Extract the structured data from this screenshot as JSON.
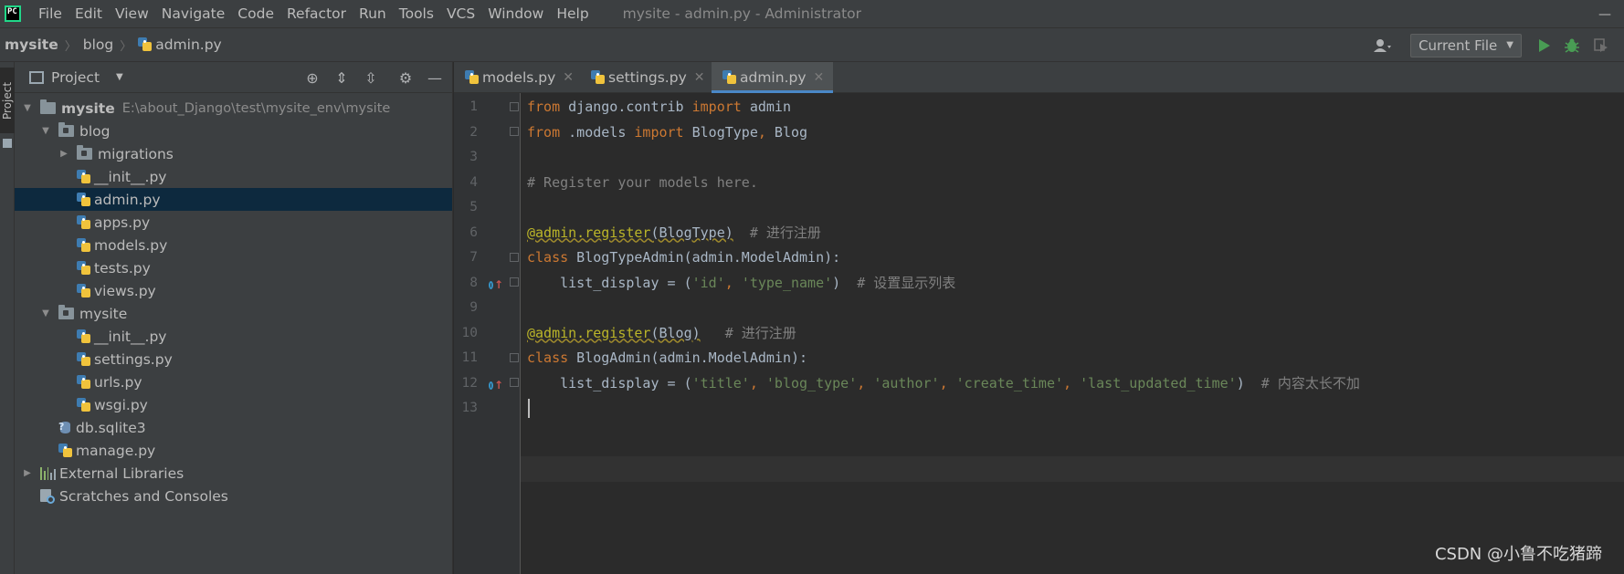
{
  "menubar": {
    "logo_text": "PC",
    "items": [
      "File",
      "Edit",
      "View",
      "Navigate",
      "Code",
      "Refactor",
      "Run",
      "Tools",
      "VCS",
      "Window",
      "Help"
    ],
    "window_title": "mysite - admin.py - Administrator"
  },
  "navbar": {
    "breadcrumbs": [
      "mysite",
      "blog",
      "admin.py"
    ],
    "run_config": "Current File"
  },
  "tool_stripe": {
    "project_label": "Project"
  },
  "project_panel": {
    "title": "Project",
    "tree": [
      {
        "label": "mysite",
        "hint": "E:\\about_Django\\test\\mysite_env\\mysite",
        "level": 0,
        "kind": "folder",
        "expanded": true
      },
      {
        "label": "blog",
        "level": 1,
        "kind": "folder",
        "expanded": true
      },
      {
        "label": "migrations",
        "level": 2,
        "kind": "folder",
        "expanded": false
      },
      {
        "label": "__init__.py",
        "level": 3,
        "kind": "py"
      },
      {
        "label": "admin.py",
        "level": 3,
        "kind": "py",
        "selected": true
      },
      {
        "label": "apps.py",
        "level": 3,
        "kind": "py"
      },
      {
        "label": "models.py",
        "level": 3,
        "kind": "py"
      },
      {
        "label": "tests.py",
        "level": 3,
        "kind": "py"
      },
      {
        "label": "views.py",
        "level": 3,
        "kind": "py"
      },
      {
        "label": "mysite",
        "level": 1,
        "kind": "folder",
        "expanded": true
      },
      {
        "label": "__init__.py",
        "level": 3,
        "kind": "py"
      },
      {
        "label": "settings.py",
        "level": 3,
        "kind": "py"
      },
      {
        "label": "urls.py",
        "level": 3,
        "kind": "py"
      },
      {
        "label": "wsgi.py",
        "level": 3,
        "kind": "py"
      },
      {
        "label": "db.sqlite3",
        "level": 2,
        "kind": "db"
      },
      {
        "label": "manage.py",
        "level": 2,
        "kind": "py"
      },
      {
        "label": "External Libraries",
        "level": 0,
        "kind": "lib",
        "expanded": false
      },
      {
        "label": "Scratches and Consoles",
        "level": 0,
        "kind": "scratch"
      }
    ]
  },
  "editor": {
    "tabs": [
      {
        "label": "models.py",
        "active": false
      },
      {
        "label": "settings.py",
        "active": false
      },
      {
        "label": "admin.py",
        "active": true
      }
    ],
    "line_numbers": [
      "1",
      "2",
      "3",
      "4",
      "5",
      "6",
      "7",
      "8",
      "9",
      "10",
      "11",
      "12",
      "13"
    ],
    "lines": [
      "from django.contrib import admin",
      "from .models import BlogType, Blog",
      "",
      "# Register your models here.",
      "",
      "@admin.register(BlogType)  # 进行注册",
      "class BlogTypeAdmin(admin.ModelAdmin):",
      "    list_display = ('id', 'type_name')  # 设置显示列表",
      "",
      "@admin.register(Blog)   # 进行注册",
      "class BlogAdmin(admin.ModelAdmin):",
      "    list_display = ('title', 'blog_type', 'author', 'create_time', 'last_updated_time')  # 内容太长不加",
      ""
    ],
    "syntax_colors": {
      "keyword": "#cc7832",
      "string": "#6a8759",
      "comment": "#808080",
      "decorator": "#bbb529",
      "text": "#a9b7c6"
    }
  },
  "watermark": "CSDN @小鲁不吃猪蹄"
}
